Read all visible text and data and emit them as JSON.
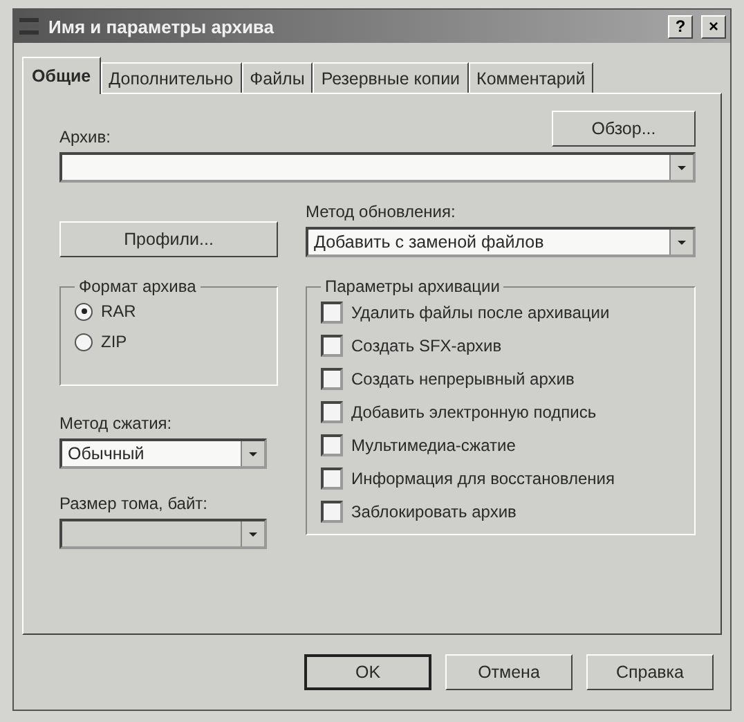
{
  "window": {
    "title": "Имя и параметры архива",
    "help_button": "?",
    "close_button": "×"
  },
  "tabs": [
    {
      "label": "Общие",
      "selected": true
    },
    {
      "label": "Дополнительно",
      "selected": false
    },
    {
      "label": "Файлы",
      "selected": false
    },
    {
      "label": "Резервные копии",
      "selected": false
    },
    {
      "label": "Комментарий",
      "selected": false
    }
  ],
  "browse_button": "Обзор...",
  "archive": {
    "label": "Архив:"
  },
  "profiles_button": "Профили...",
  "update_method": {
    "label": "Метод обновления:",
    "value": "Добавить с заменой файлов"
  },
  "archive_format": {
    "title": "Формат архива",
    "options": [
      {
        "label": "RAR",
        "selected": true
      },
      {
        "label": "ZIP",
        "selected": false
      }
    ]
  },
  "compression_method": {
    "label": "Метод сжатия:",
    "value": "Обычный"
  },
  "volume_size": {
    "label": "Размер тома, байт:"
  },
  "archiving_options": {
    "title": "Параметры архивации",
    "options": [
      {
        "label": "Удалить файлы после архивации",
        "checked": false
      },
      {
        "label": "Создать SFX-архив",
        "checked": false
      },
      {
        "label": "Создать непрерывный архив",
        "checked": false
      },
      {
        "label": "Добавить электронную подпись",
        "checked": false
      },
      {
        "label": "Мультимедиа-сжатие",
        "checked": false
      },
      {
        "label": "Информация для восстановления",
        "checked": false
      },
      {
        "label": "Заблокировать архив",
        "checked": false
      }
    ]
  },
  "buttons": [
    {
      "label": "OK",
      "default": true
    },
    {
      "label": "Отмена",
      "default": false
    },
    {
      "label": "Справка",
      "default": false
    }
  ]
}
